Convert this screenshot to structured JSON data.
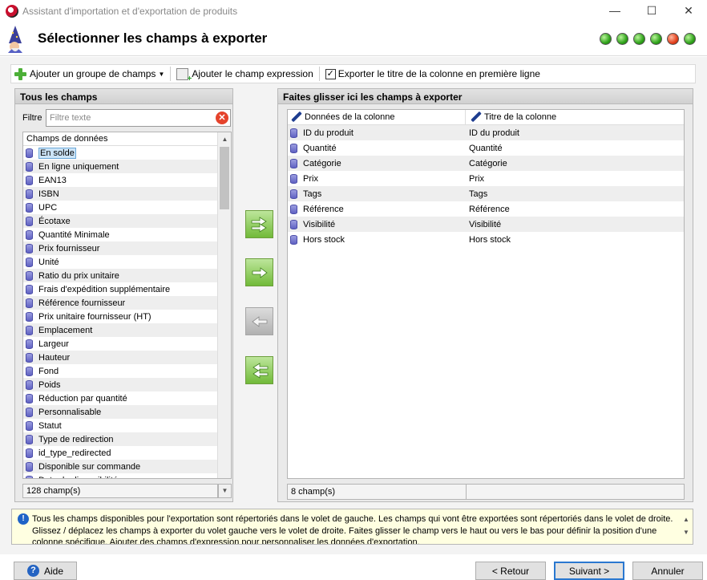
{
  "window": {
    "title": "Assistant d'importation et d'exportation de produits",
    "minimize": "—",
    "maximize": "☐",
    "close": "✕"
  },
  "header": {
    "title": "Sélectionner les champs à exporter",
    "step_dots": [
      "green",
      "green",
      "green",
      "green",
      "red",
      "green"
    ]
  },
  "toolbar": {
    "add_group_label": "Ajouter un groupe de champs",
    "add_expression_label": "Ajouter le champ expression",
    "export_title_label": "Exporter le titre de la colonne en première ligne",
    "export_title_checked": true
  },
  "left_panel": {
    "title": "Tous les champs",
    "filter_label": "Filtre",
    "filter_placeholder": "Filtre texte",
    "column_header": "Champs de données",
    "selected_index": 0,
    "fields": [
      "En solde",
      "En ligne uniquement",
      "EAN13",
      "ISBN",
      "UPC",
      "Écotaxe",
      "Quantité Minimale",
      "Prix fournisseur",
      "Unité",
      "Ratio du prix unitaire",
      "Frais d'expédition supplémentaire",
      "Référence fournisseur",
      "Prix unitaire fournisseur (HT)",
      "Emplacement",
      "Largeur",
      "Hauteur",
      "Fond",
      "Poids",
      "Réduction par quantité",
      "Personnalisable",
      "Statut",
      "Type de redirection",
      "id_type_redirected",
      "Disponible sur commande",
      "Date de disponibilité"
    ],
    "count": "128 champ(s)"
  },
  "right_panel": {
    "title": "Faites glisser ici les champs à exporter",
    "col_data": "Données de la colonne",
    "col_title": "Titre de la colonne",
    "rows": [
      {
        "data": "ID du produit",
        "title": "ID du produit"
      },
      {
        "data": "Quantité",
        "title": "Quantité"
      },
      {
        "data": "Catégorie",
        "title": "Catégorie"
      },
      {
        "data": "Prix",
        "title": "Prix"
      },
      {
        "data": "Tags",
        "title": "Tags"
      },
      {
        "data": "Référence",
        "title": "Référence"
      },
      {
        "data": "Visibilité",
        "title": "Visibilité"
      },
      {
        "data": "Hors stock",
        "title": "Hors stock"
      }
    ],
    "count": "8 champ(s)"
  },
  "info": {
    "text": "Tous les champs disponibles pour l'exportation sont répertoriés dans le volet de gauche. Les champs qui vont être exportées sont répertoriés dans le volet de droite. Glissez / déplacez les champs à exporter du volet gauche vers le volet de droite. Faites glisser le champ vers le haut ou vers le bas pour définir la position d'une colonne spécifique. Ajouter des champs d'expression pour personnaliser les données d'exportation."
  },
  "buttons": {
    "help": "Aide",
    "back": "< Retour",
    "next": "Suivant >",
    "cancel": "Annuler"
  },
  "colors": {
    "accent": "#2a78d0",
    "selection": "#cce4f7",
    "arrow_enabled": "#71ba39",
    "info_background": "#ffffe1"
  }
}
